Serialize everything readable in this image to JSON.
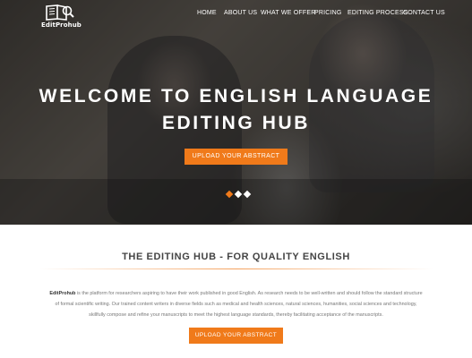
{
  "brand": {
    "name": "EditProhub"
  },
  "nav": {
    "items": [
      {
        "label": "HOME"
      },
      {
        "label": "ABOUT US"
      },
      {
        "label": "WHAT WE OFFER"
      },
      {
        "label": "PRICING"
      },
      {
        "label": "EDITING PROCESS"
      },
      {
        "label": "CONTACT US"
      }
    ]
  },
  "hero": {
    "title_line1": "WELCOME TO ENGLISH LANGUAGE",
    "title_line2": "EDITING HUB",
    "button_label": "UPLOAD YOUR ABSTRACT",
    "slides": {
      "count": 3,
      "active_index": 0
    }
  },
  "about": {
    "heading": "THE EDITING HUB - FOR QUALITY ENGLISH",
    "brand_bold": "EditProhub",
    "description_line1": " is the platform for researchers aspiring to have their work published in good English. As research needs to be well-written and should follow the standard structure",
    "description_line2": "of formal scientific writing. Our trained content writers in diverse fields such as medical and health sciences, natural sciences, humanities, social sciences and technology,",
    "description_line3": "skillfully compose and refine your manuscripts to meet the highest language standards, thereby facilitating acceptance of the manuscripts.",
    "button_label": "UPLOAD YOUR ABSTRACT"
  },
  "colors": {
    "accent": "#f07a1a",
    "text_dark": "#444444",
    "text_muted": "#777777"
  },
  "icons": {
    "logo": "book-glass-icon"
  }
}
